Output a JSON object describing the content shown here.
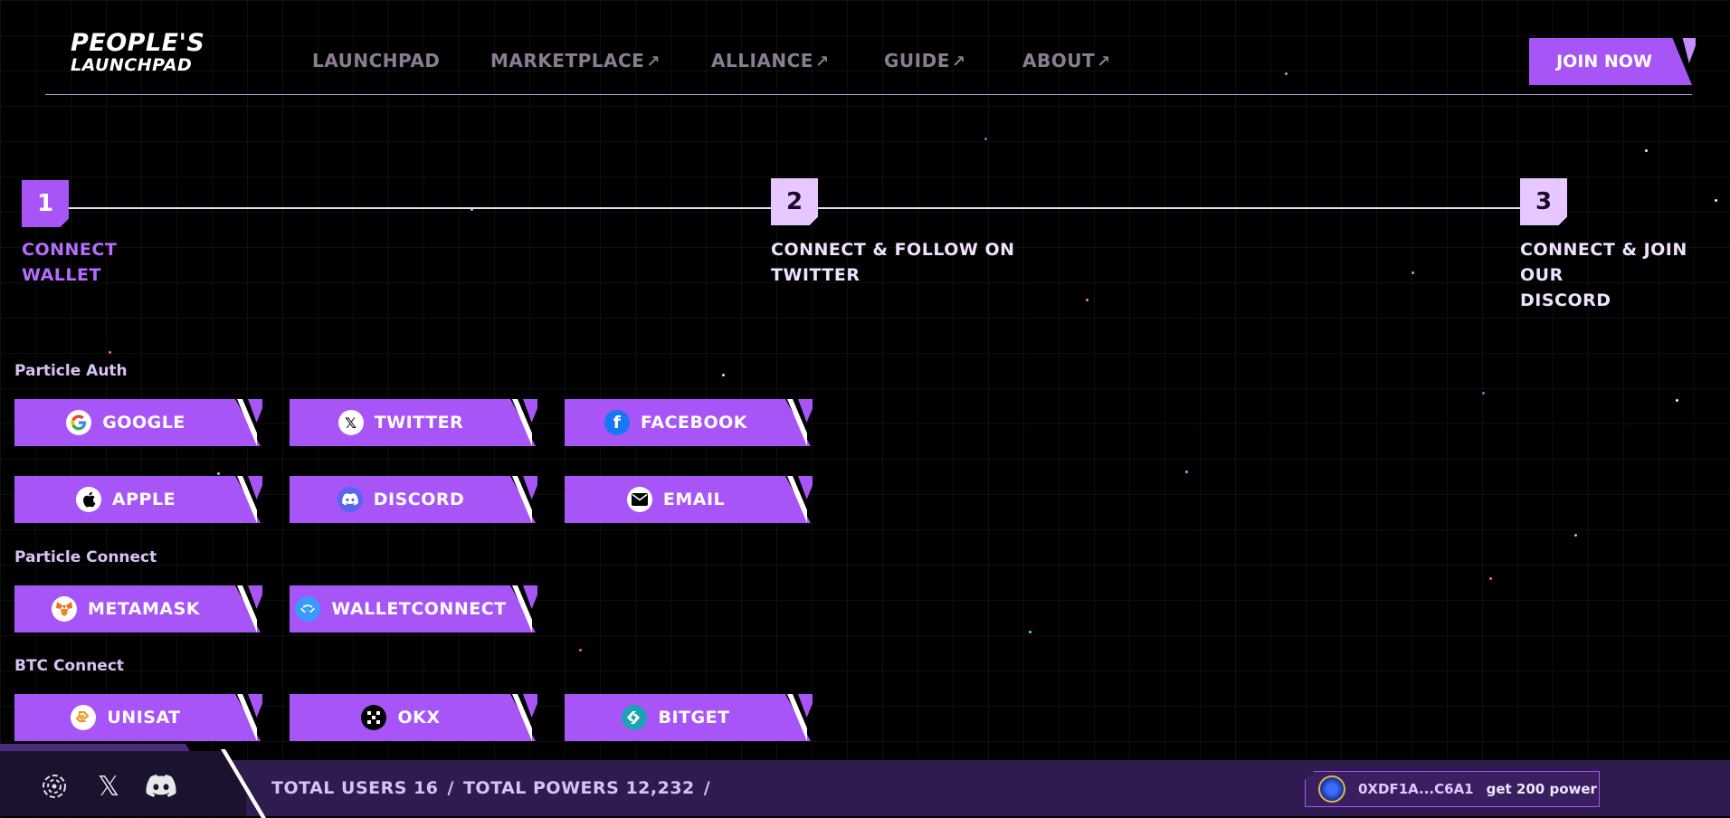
{
  "header": {
    "logo_line1": "PEOPLE'S",
    "logo_line2": "LAUNCHPAD",
    "nav": [
      {
        "label": "LAUNCHPAD",
        "external": false
      },
      {
        "label": "MARKETPLACE",
        "external": true
      },
      {
        "label": "ALLIANCE",
        "external": true
      },
      {
        "label": "GUIDE",
        "external": true
      },
      {
        "label": "ABOUT",
        "external": true
      }
    ],
    "join_label": "JOIN NOW"
  },
  "steps": [
    {
      "number": "1",
      "label_line1": "CONNECT",
      "label_line2": "WALLET",
      "status": "active"
    },
    {
      "number": "2",
      "label_line1": "CONNECT & FOLLOW ON",
      "label_line2": "TWITTER",
      "status": "pending"
    },
    {
      "number": "3",
      "label_line1": "CONNECT & JOIN OUR",
      "label_line2": "DISCORD",
      "status": "pending"
    }
  ],
  "sections": {
    "particle_auth": {
      "title": "Particle Auth",
      "buttons": [
        {
          "label": "GOOGLE",
          "icon": "google-icon"
        },
        {
          "label": "TWITTER",
          "icon": "x-icon"
        },
        {
          "label": "FACEBOOK",
          "icon": "facebook-icon"
        },
        {
          "label": "APPLE",
          "icon": "apple-icon"
        },
        {
          "label": "DISCORD",
          "icon": "discord-icon"
        },
        {
          "label": "EMAIL",
          "icon": "email-icon"
        }
      ]
    },
    "particle_connect": {
      "title": "Particle Connect",
      "buttons": [
        {
          "label": "METAMASK",
          "icon": "metamask-icon"
        },
        {
          "label": "WALLETCONNECT",
          "icon": "walletconnect-icon"
        }
      ]
    },
    "btc_connect": {
      "title": "BTC Connect",
      "buttons": [
        {
          "label": "UNISAT",
          "icon": "unisat-icon"
        },
        {
          "label": "OKX",
          "icon": "okx-icon"
        },
        {
          "label": "BITGET",
          "icon": "bitget-icon"
        }
      ]
    }
  },
  "footer": {
    "total_users_label": "TOTAL USERS",
    "total_users": "16",
    "separator": "/",
    "total_powers_label": "TOTAL POWERS",
    "total_powers": "12,232",
    "wallet_address": "0XDF1A...C6A1",
    "power_text": "get 200 power"
  },
  "colors": {
    "accent": "#a855f7",
    "footer_bg": "#2f1b4f",
    "step_pending": "#e7c7ff"
  }
}
